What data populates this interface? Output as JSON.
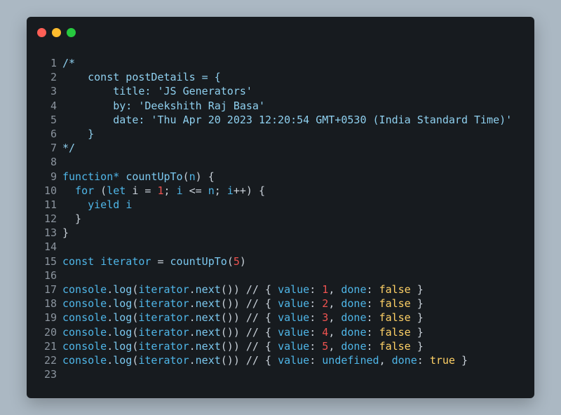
{
  "window": {
    "controls": [
      {
        "name": "close",
        "color": "#ff5f56"
      },
      {
        "name": "minimize",
        "color": "#ffbd2e"
      },
      {
        "name": "maximize",
        "color": "#27c93f"
      }
    ]
  },
  "colors": {
    "background": "#abb8c3",
    "editor_bg": "#171b1f",
    "comment": "#8fd0ef",
    "keyword": "#4fb6e8",
    "number": "#ef5350",
    "boolean": "#ffd166",
    "line_number": "#8b949e"
  },
  "code": {
    "lines": [
      {
        "n": "1",
        "tokens": [
          {
            "t": "/*",
            "c": "comment"
          }
        ]
      },
      {
        "n": "2",
        "tokens": [
          {
            "t": "    const postDetails = {",
            "c": "comment"
          }
        ]
      },
      {
        "n": "3",
        "tokens": [
          {
            "t": "        title: 'JS Generators'",
            "c": "comment"
          }
        ]
      },
      {
        "n": "4",
        "tokens": [
          {
            "t": "        by: 'Deekshith Raj Basa'",
            "c": "comment"
          }
        ]
      },
      {
        "n": "5",
        "tokens": [
          {
            "t": "        date: 'Thu Apr 20 2023 12:20:54 GMT+0530 (India Standard Time)'",
            "c": "comment"
          }
        ]
      },
      {
        "n": "6",
        "tokens": [
          {
            "t": "    }",
            "c": "comment"
          }
        ]
      },
      {
        "n": "7",
        "tokens": [
          {
            "t": "*/",
            "c": "comment"
          }
        ]
      },
      {
        "n": "8",
        "tokens": []
      },
      {
        "n": "9",
        "tokens": [
          {
            "t": "function*",
            "c": "key"
          },
          {
            "t": " ",
            "c": "plain"
          },
          {
            "t": "countUpTo",
            "c": "func"
          },
          {
            "t": "(",
            "c": "punc"
          },
          {
            "t": "n",
            "c": "key"
          },
          {
            "t": ") {",
            "c": "punc"
          }
        ]
      },
      {
        "n": "10",
        "tokens": [
          {
            "t": "  for",
            "c": "key"
          },
          {
            "t": " (",
            "c": "punc"
          },
          {
            "t": "let",
            "c": "key"
          },
          {
            "t": " i = ",
            "c": "plain"
          },
          {
            "t": "1",
            "c": "num"
          },
          {
            "t": "; ",
            "c": "punc"
          },
          {
            "t": "i",
            "c": "key"
          },
          {
            "t": " <= ",
            "c": "plain"
          },
          {
            "t": "n",
            "c": "key"
          },
          {
            "t": "; ",
            "c": "punc"
          },
          {
            "t": "i",
            "c": "key"
          },
          {
            "t": "++) {",
            "c": "punc"
          }
        ]
      },
      {
        "n": "11",
        "tokens": [
          {
            "t": "    yield",
            "c": "key"
          },
          {
            "t": " ",
            "c": "plain"
          },
          {
            "t": "i",
            "c": "key"
          }
        ]
      },
      {
        "n": "12",
        "tokens": [
          {
            "t": "  }",
            "c": "punc"
          }
        ]
      },
      {
        "n": "13",
        "tokens": [
          {
            "t": "}",
            "c": "punc"
          }
        ]
      },
      {
        "n": "14",
        "tokens": []
      },
      {
        "n": "15",
        "tokens": [
          {
            "t": "const",
            "c": "key"
          },
          {
            "t": " ",
            "c": "plain"
          },
          {
            "t": "iterator",
            "c": "key"
          },
          {
            "t": " = ",
            "c": "plain"
          },
          {
            "t": "countUpTo",
            "c": "func"
          },
          {
            "t": "(",
            "c": "punc"
          },
          {
            "t": "5",
            "c": "num"
          },
          {
            "t": ")",
            "c": "punc"
          }
        ]
      },
      {
        "n": "16",
        "tokens": []
      },
      {
        "n": "17",
        "tokens": [
          {
            "t": "console",
            "c": "key"
          },
          {
            "t": ".",
            "c": "punc"
          },
          {
            "t": "log",
            "c": "func"
          },
          {
            "t": "(",
            "c": "punc"
          },
          {
            "t": "iterator",
            "c": "key"
          },
          {
            "t": ".",
            "c": "punc"
          },
          {
            "t": "next",
            "c": "func"
          },
          {
            "t": "()) // { ",
            "c": "punc"
          },
          {
            "t": "value",
            "c": "key"
          },
          {
            "t": ": ",
            "c": "punc"
          },
          {
            "t": "1",
            "c": "num"
          },
          {
            "t": ", ",
            "c": "punc"
          },
          {
            "t": "done",
            "c": "key"
          },
          {
            "t": ": ",
            "c": "punc"
          },
          {
            "t": "false",
            "c": "bool"
          },
          {
            "t": " }",
            "c": "punc"
          }
        ]
      },
      {
        "n": "18",
        "tokens": [
          {
            "t": "console",
            "c": "key"
          },
          {
            "t": ".",
            "c": "punc"
          },
          {
            "t": "log",
            "c": "func"
          },
          {
            "t": "(",
            "c": "punc"
          },
          {
            "t": "iterator",
            "c": "key"
          },
          {
            "t": ".",
            "c": "punc"
          },
          {
            "t": "next",
            "c": "func"
          },
          {
            "t": "()) // { ",
            "c": "punc"
          },
          {
            "t": "value",
            "c": "key"
          },
          {
            "t": ": ",
            "c": "punc"
          },
          {
            "t": "2",
            "c": "num"
          },
          {
            "t": ", ",
            "c": "punc"
          },
          {
            "t": "done",
            "c": "key"
          },
          {
            "t": ": ",
            "c": "punc"
          },
          {
            "t": "false",
            "c": "bool"
          },
          {
            "t": " }",
            "c": "punc"
          }
        ]
      },
      {
        "n": "19",
        "tokens": [
          {
            "t": "console",
            "c": "key"
          },
          {
            "t": ".",
            "c": "punc"
          },
          {
            "t": "log",
            "c": "func"
          },
          {
            "t": "(",
            "c": "punc"
          },
          {
            "t": "iterator",
            "c": "key"
          },
          {
            "t": ".",
            "c": "punc"
          },
          {
            "t": "next",
            "c": "func"
          },
          {
            "t": "()) // { ",
            "c": "punc"
          },
          {
            "t": "value",
            "c": "key"
          },
          {
            "t": ": ",
            "c": "punc"
          },
          {
            "t": "3",
            "c": "num"
          },
          {
            "t": ", ",
            "c": "punc"
          },
          {
            "t": "done",
            "c": "key"
          },
          {
            "t": ": ",
            "c": "punc"
          },
          {
            "t": "false",
            "c": "bool"
          },
          {
            "t": " }",
            "c": "punc"
          }
        ]
      },
      {
        "n": "20",
        "tokens": [
          {
            "t": "console",
            "c": "key"
          },
          {
            "t": ".",
            "c": "punc"
          },
          {
            "t": "log",
            "c": "func"
          },
          {
            "t": "(",
            "c": "punc"
          },
          {
            "t": "iterator",
            "c": "key"
          },
          {
            "t": ".",
            "c": "punc"
          },
          {
            "t": "next",
            "c": "func"
          },
          {
            "t": "()) // { ",
            "c": "punc"
          },
          {
            "t": "value",
            "c": "key"
          },
          {
            "t": ": ",
            "c": "punc"
          },
          {
            "t": "4",
            "c": "num"
          },
          {
            "t": ", ",
            "c": "punc"
          },
          {
            "t": "done",
            "c": "key"
          },
          {
            "t": ": ",
            "c": "punc"
          },
          {
            "t": "false",
            "c": "bool"
          },
          {
            "t": " }",
            "c": "punc"
          }
        ]
      },
      {
        "n": "21",
        "tokens": [
          {
            "t": "console",
            "c": "key"
          },
          {
            "t": ".",
            "c": "punc"
          },
          {
            "t": "log",
            "c": "func"
          },
          {
            "t": "(",
            "c": "punc"
          },
          {
            "t": "iterator",
            "c": "key"
          },
          {
            "t": ".",
            "c": "punc"
          },
          {
            "t": "next",
            "c": "func"
          },
          {
            "t": "()) // { ",
            "c": "punc"
          },
          {
            "t": "value",
            "c": "key"
          },
          {
            "t": ": ",
            "c": "punc"
          },
          {
            "t": "5",
            "c": "num"
          },
          {
            "t": ", ",
            "c": "punc"
          },
          {
            "t": "done",
            "c": "key"
          },
          {
            "t": ": ",
            "c": "punc"
          },
          {
            "t": "false",
            "c": "bool"
          },
          {
            "t": " }",
            "c": "punc"
          }
        ]
      },
      {
        "n": "22",
        "tokens": [
          {
            "t": "console",
            "c": "key"
          },
          {
            "t": ".",
            "c": "punc"
          },
          {
            "t": "log",
            "c": "func"
          },
          {
            "t": "(",
            "c": "punc"
          },
          {
            "t": "iterator",
            "c": "key"
          },
          {
            "t": ".",
            "c": "punc"
          },
          {
            "t": "next",
            "c": "func"
          },
          {
            "t": "()) // { ",
            "c": "punc"
          },
          {
            "t": "value",
            "c": "key"
          },
          {
            "t": ": ",
            "c": "punc"
          },
          {
            "t": "undefined",
            "c": "key"
          },
          {
            "t": ", ",
            "c": "punc"
          },
          {
            "t": "done",
            "c": "key"
          },
          {
            "t": ": ",
            "c": "punc"
          },
          {
            "t": "true",
            "c": "bool"
          },
          {
            "t": " }",
            "c": "punc"
          }
        ]
      },
      {
        "n": "23",
        "tokens": []
      }
    ]
  }
}
